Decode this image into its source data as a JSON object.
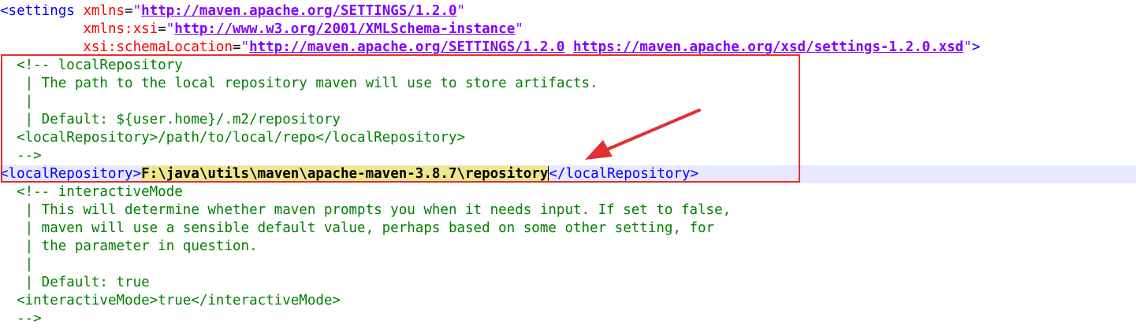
{
  "editor": {
    "lines": {
      "l1": {
        "tag_open": "<settings",
        "attr": "xmlns",
        "eq": "=",
        "q1": "\"",
        "url": "http://maven.apache.org/SETTINGS/1.2.0",
        "q2": "\""
      },
      "l2": {
        "indent": "          ",
        "attr": "xmlns:xsi",
        "eq": "=",
        "q1": "\"",
        "url": "http://www.w3.org/2001/XMLSchema-instance",
        "q2": "\""
      },
      "l3": {
        "indent": "          ",
        "attr": "xsi:schemaLocation",
        "eq": "=",
        "q1": "\"",
        "url1": "http://maven.apache.org/SETTINGS/1.2.0",
        "space": " ",
        "url2": "https://maven.apache.org/xsd/settings-1.2.0.xsd",
        "q2": "\"",
        "tag_close": ">"
      },
      "l4": "  <!-- localRepository",
      "l5": "   | The path to the local repository maven will use to store artifacts.",
      "l6": "   |",
      "l7": "   | Default: ${user.home}/.m2/repository",
      "l8": "  <localRepository>/path/to/local/repo</localRepository>",
      "l9": "  -->",
      "l10": {
        "open": "<localRepository>",
        "value": "F:\\java\\utils\\maven\\apache-maven-3.8.7\\repository",
        "close": "</localRepository>"
      },
      "l11": "  <!-- interactiveMode",
      "l12": "   | This will determine whether maven prompts you when it needs input. If set to false,",
      "l13": "   | maven will use a sensible default value, perhaps based on some other setting, for",
      "l14": "   | the parameter in question.",
      "l15": "   |",
      "l16": "   | Default: true",
      "l17": "  <interactiveMode>true</interactiveMode>",
      "l18": "  -->"
    }
  },
  "annotation": {
    "box_color": "#e03030",
    "arrow_color": "#e03030",
    "highlight_color": "#f0e68c"
  }
}
